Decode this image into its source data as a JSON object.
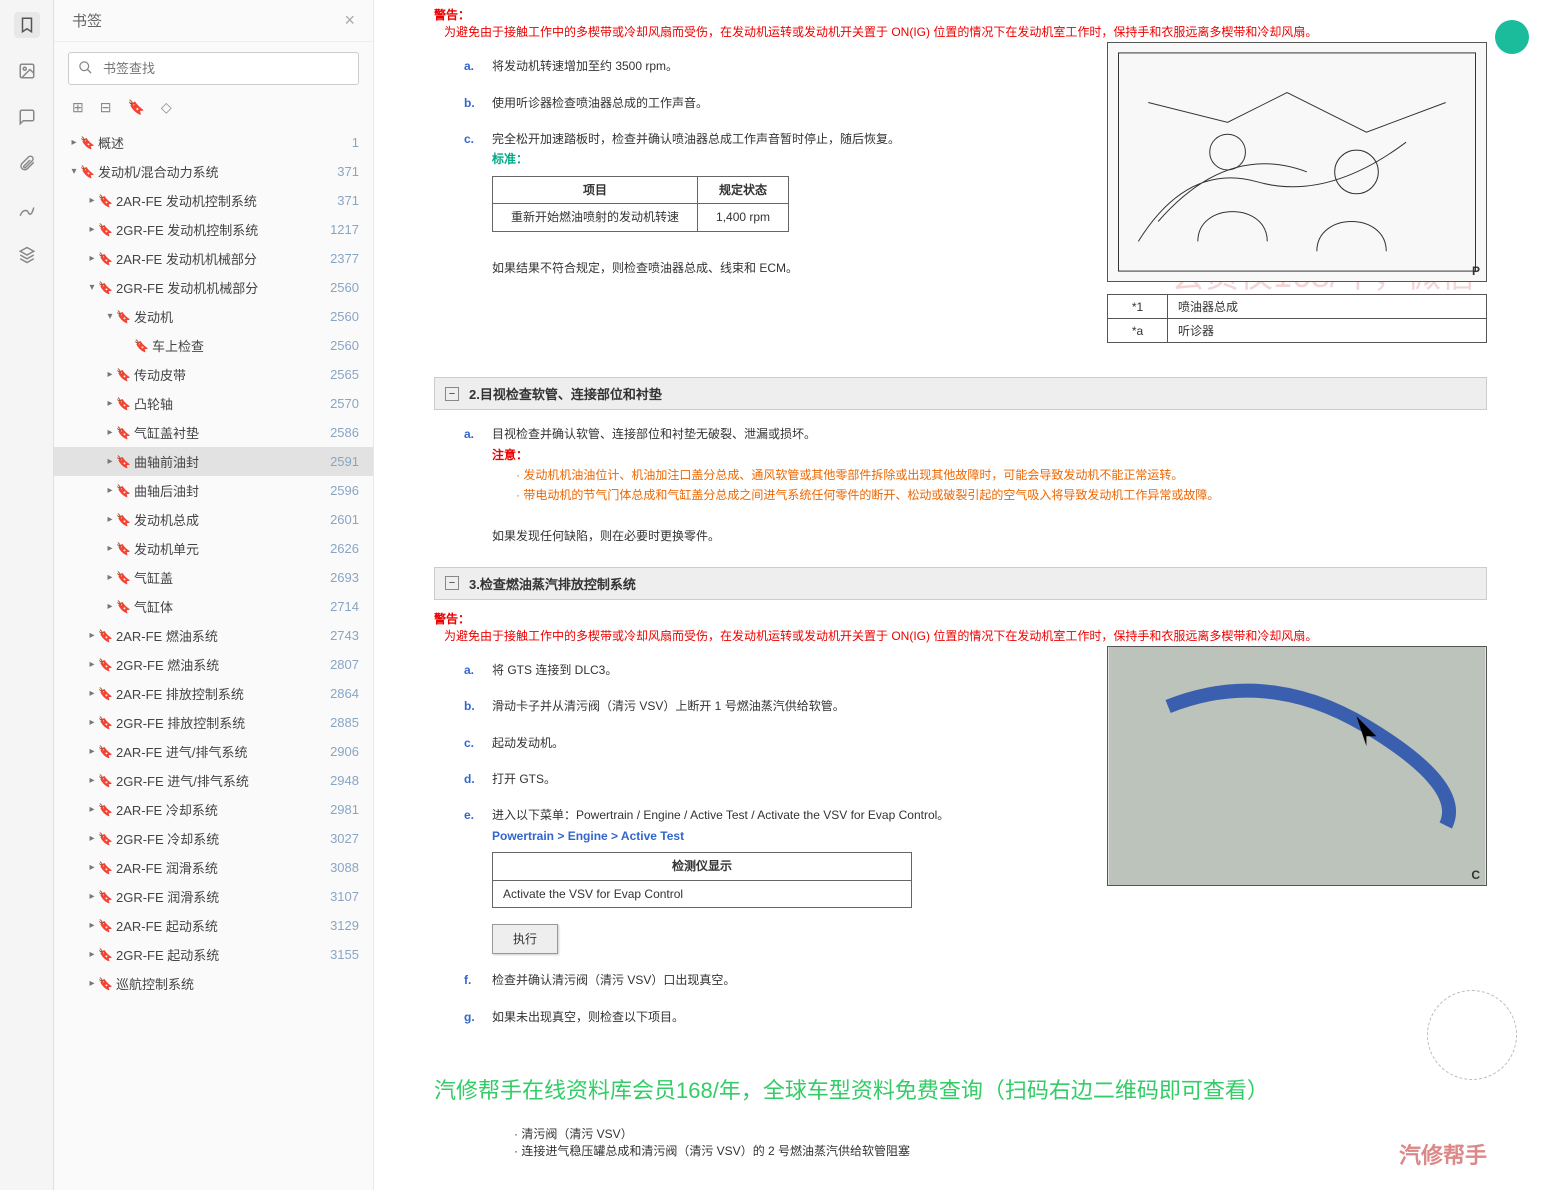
{
  "sidebar": {
    "title": "书签",
    "search_placeholder": "书签查找",
    "items": [
      {
        "d": 0,
        "caret": "▸",
        "label": "概述",
        "page": "1"
      },
      {
        "d": 0,
        "caret": "▾",
        "label": "发动机/混合动力系统",
        "page": "371"
      },
      {
        "d": 1,
        "caret": "▸",
        "label": "2AR-FE 发动机控制系统",
        "page": "371"
      },
      {
        "d": 1,
        "caret": "▸",
        "label": "2GR-FE 发动机控制系统",
        "page": "1217"
      },
      {
        "d": 1,
        "caret": "▸",
        "label": "2AR-FE 发动机机械部分",
        "page": "2377"
      },
      {
        "d": 1,
        "caret": "▾",
        "label": "2GR-FE 发动机机械部分",
        "page": "2560"
      },
      {
        "d": 2,
        "caret": "▾",
        "label": "发动机",
        "page": "2560"
      },
      {
        "d": 3,
        "caret": "",
        "label": "车上检查",
        "page": "2560"
      },
      {
        "d": 2,
        "caret": "▸",
        "label": "传动皮带",
        "page": "2565"
      },
      {
        "d": 2,
        "caret": "▸",
        "label": "凸轮轴",
        "page": "2570"
      },
      {
        "d": 2,
        "caret": "▸",
        "label": "气缸盖衬垫",
        "page": "2586"
      },
      {
        "d": 2,
        "caret": "▸",
        "label": "曲轴前油封",
        "page": "2591",
        "sel": true
      },
      {
        "d": 2,
        "caret": "▸",
        "label": "曲轴后油封",
        "page": "2596"
      },
      {
        "d": 2,
        "caret": "▸",
        "label": "发动机总成",
        "page": "2601"
      },
      {
        "d": 2,
        "caret": "▸",
        "label": "发动机单元",
        "page": "2626"
      },
      {
        "d": 2,
        "caret": "▸",
        "label": "气缸盖",
        "page": "2693"
      },
      {
        "d": 2,
        "caret": "▸",
        "label": "气缸体",
        "page": "2714"
      },
      {
        "d": 1,
        "caret": "▸",
        "label": "2AR-FE 燃油系统",
        "page": "2743"
      },
      {
        "d": 1,
        "caret": "▸",
        "label": "2GR-FE 燃油系统",
        "page": "2807"
      },
      {
        "d": 1,
        "caret": "▸",
        "label": "2AR-FE 排放控制系统",
        "page": "2864"
      },
      {
        "d": 1,
        "caret": "▸",
        "label": "2GR-FE 排放控制系统",
        "page": "2885"
      },
      {
        "d": 1,
        "caret": "▸",
        "label": "2AR-FE 进气/排气系统",
        "page": "2906"
      },
      {
        "d": 1,
        "caret": "▸",
        "label": "2GR-FE 进气/排气系统",
        "page": "2948"
      },
      {
        "d": 1,
        "caret": "▸",
        "label": "2AR-FE 冷却系统",
        "page": "2981"
      },
      {
        "d": 1,
        "caret": "▸",
        "label": "2GR-FE 冷却系统",
        "page": "3027"
      },
      {
        "d": 1,
        "caret": "▸",
        "label": "2AR-FE 润滑系统",
        "page": "3088"
      },
      {
        "d": 1,
        "caret": "▸",
        "label": "2GR-FE 润滑系统",
        "page": "3107"
      },
      {
        "d": 1,
        "caret": "▸",
        "label": "2AR-FE 起动系统",
        "page": "3129"
      },
      {
        "d": 1,
        "caret": "▸",
        "label": "2GR-FE 起动系统",
        "page": "3155"
      },
      {
        "d": 1,
        "caret": "▸",
        "label": "巡航控制系统",
        "page": ""
      }
    ]
  },
  "doc": {
    "warn_label": "警告：",
    "warn1": "为避免由于接触工作中的多楔带或冷却风扇而受伤，在发动机运转或发动机开关置于 ON(IG) 位置的情况下在发动机室工作时，保持手和衣服远离多楔带和冷却风扇。",
    "s1a": "将发动机转速增加至约 3500 rpm。",
    "s1b": "使用听诊器检查喷油器总成的工作声音。",
    "s1c": "完全松开加速踏板时，检查并确认喷油器总成工作声音暂时停止，随后恢复。",
    "std_label": "标准：",
    "t1_h1": "项目",
    "t1_h2": "规定状态",
    "t1_r1": "重新开始燃油喷射的发动机转速",
    "t1_r2": "1,400 rpm",
    "s1_after": "如果结果不符合规定，则检查喷油器总成、线束和 ECM。",
    "leg1_k1": "*1",
    "leg1_v1": "喷油器总成",
    "leg1_k2": "*a",
    "leg1_v2": "听诊器",
    "sec2": "2.目视检查软管、连接部位和衬垫",
    "s2a": "目视检查并确认软管、连接部位和衬垫无破裂、泄漏或损坏。",
    "note_label": "注意：",
    "note1": "发动机机油油位计、机油加注口盖分总成、通风软管或其他零部件拆除或出现其他故障时，可能会导致发动机不能正常运转。",
    "note2": "带电动机的节气门体总成和气缸盖分总成之间进气系统任何零件的断开、松动或破裂引起的空气吸入将导致发动机工作异常或故障。",
    "s2_after": "如果发现任何缺陷，则在必要时更换零件。",
    "sec3": "3.检查燃油蒸汽排放控制系统",
    "s3a": "将 GTS 连接到 DLC3。",
    "s3b": "滑动卡子并从清污阀（清污 VSV）上断开 1 号燃油蒸汽供给软管。",
    "s3c": "起动发动机。",
    "s3d": "打开 GTS。",
    "s3e": "进入以下菜单：Powertrain / Engine / Active Test / Activate the VSV for Evap Control。",
    "nav": "Powertrain > Engine > Active Test",
    "t2_h": "检测仪显示",
    "t2_r": "Activate the VSV for Evap Control",
    "btn": "执行",
    "s3f": "检查并确认清污阀（清污 VSV）口出现真空。",
    "s3g": "如果未出现真空，则检查以下项目。",
    "bul1": "清污阀（清污 VSV）",
    "bul2": "连接进气稳压罐总成和清污阀（清污 VSV）的 2 号燃油蒸汽供给软管阻塞",
    "promo": "汽修帮手在线资料库会员168/年，全球车型资料免费查询（扫码右边二维码即可查看）",
    "wm1": "汽修帮手在线资料库",
    "wm2": "会员仅168/年，微信",
    "brand": "汽修帮手"
  }
}
